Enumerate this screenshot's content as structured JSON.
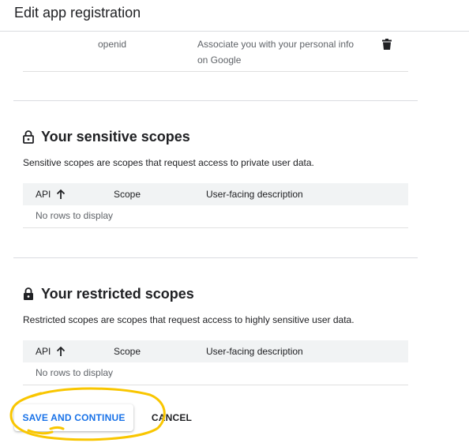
{
  "header": {
    "title": "Edit app registration"
  },
  "non_sensitive_row": {
    "scope": "openid",
    "description": "Associate you with your personal info on Google",
    "delete_icon": "trash-icon"
  },
  "sensitive": {
    "title": "Your sensitive scopes",
    "icon": "lock-open-icon",
    "description": "Sensitive scopes are scopes that request access to private user data.",
    "columns": [
      "API",
      "Scope",
      "User-facing description"
    ],
    "sort_icon": "arrow-up-icon",
    "empty_text": "No rows to display"
  },
  "restricted": {
    "title": "Your restricted scopes",
    "icon": "lock-icon",
    "description": "Restricted scopes are scopes that request access to highly sensitive user data.",
    "columns": [
      "API",
      "Scope",
      "User-facing description"
    ],
    "sort_icon": "arrow-up-icon",
    "empty_text": "No rows to display"
  },
  "actions": {
    "save_label": "SAVE AND CONTINUE",
    "cancel_label": "CANCEL"
  },
  "colors": {
    "primary_blue": "#1a73e8",
    "annotation_yellow": "#f9c600",
    "table_header_bg": "#f1f3f4"
  }
}
